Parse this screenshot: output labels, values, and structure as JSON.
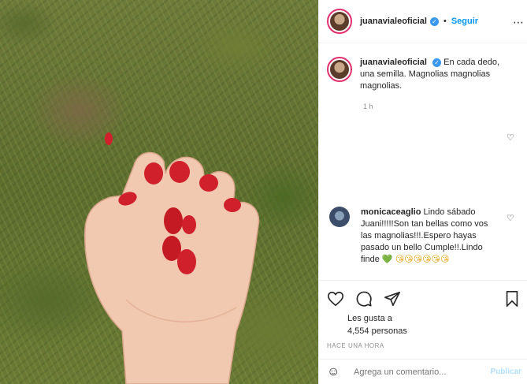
{
  "post": {
    "username": "juanavialeoficial",
    "verified_mark": "✓",
    "separator": "•",
    "follow_label": "Seguir",
    "more_label": "⋯"
  },
  "caption": {
    "username": "juanavialeoficial",
    "text": "En cada dedo, una semilla. Magnolias magnolias magnolias.",
    "time": "1 h"
  },
  "comment": {
    "username": "monicaceaglio",
    "text": "Lindo sábado Juani!!!!!Son tan bellas como vos las magnolias!!!.Espero hayas pasado un bello Cumple!!.Lindo finde",
    "green_heart": "💚",
    "emojis": "😘😘😘😘😘😘"
  },
  "actions": {
    "likes_prefix": "Les gusta a",
    "likes_count": "4,554 personas",
    "timestamp": "HACE UNA HORA"
  },
  "composer": {
    "placeholder": "Agrega un comentario...",
    "post_label": "Publicar",
    "emoji_icon": "☺"
  },
  "colors": {
    "follow": "#0095f6",
    "nail": "#d0202b",
    "verified": "#3897f0"
  }
}
